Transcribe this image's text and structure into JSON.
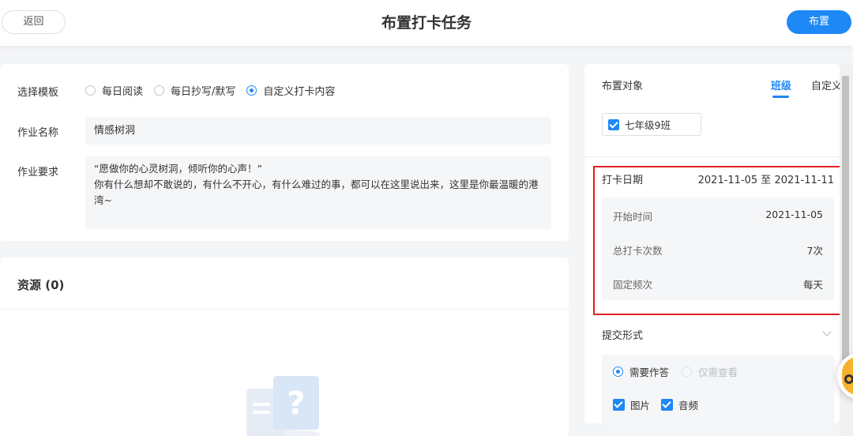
{
  "header": {
    "back_label": "返回",
    "title": "布置打卡任务",
    "publish_label": "布置"
  },
  "form": {
    "template_label": "选择模板",
    "template_options": [
      "每日阅读",
      "每日抄写/默写",
      "自定义打卡内容"
    ],
    "template_selected": "自定义打卡内容",
    "name_label": "作业名称",
    "name_value": "情感树洞",
    "requirement_label": "作业要求",
    "requirement_line1": "“愿做你的心灵树洞，倾听你的心声！”",
    "requirement_line2": "你有什么想却不敢说的，有什么不开心，有什么难过的事，都可以在这里说出来，这里是你最温暖的港湾~"
  },
  "resources": {
    "title": "资源 (0)"
  },
  "target": {
    "label": "布置对象",
    "tabs": [
      "班级",
      "自定义"
    ],
    "active_tab": "班级",
    "selected_class": "七年级9班"
  },
  "checkin": {
    "date_label": "打卡日期",
    "date_range": "2021-11-05 至 2021-11-11",
    "start_label": "开始时间",
    "start_value": "2021-11-05",
    "count_label": "总打卡次数",
    "count_value": "7次",
    "freq_label": "固定频次",
    "freq_value": "每天"
  },
  "submit": {
    "label": "提交形式",
    "options": [
      "需要作答",
      "仅需查看"
    ],
    "selected": "需要作答",
    "media": [
      "图片",
      "音频"
    ]
  },
  "colors": {
    "accent": "#1e88f5",
    "highlight": "#e02020"
  }
}
